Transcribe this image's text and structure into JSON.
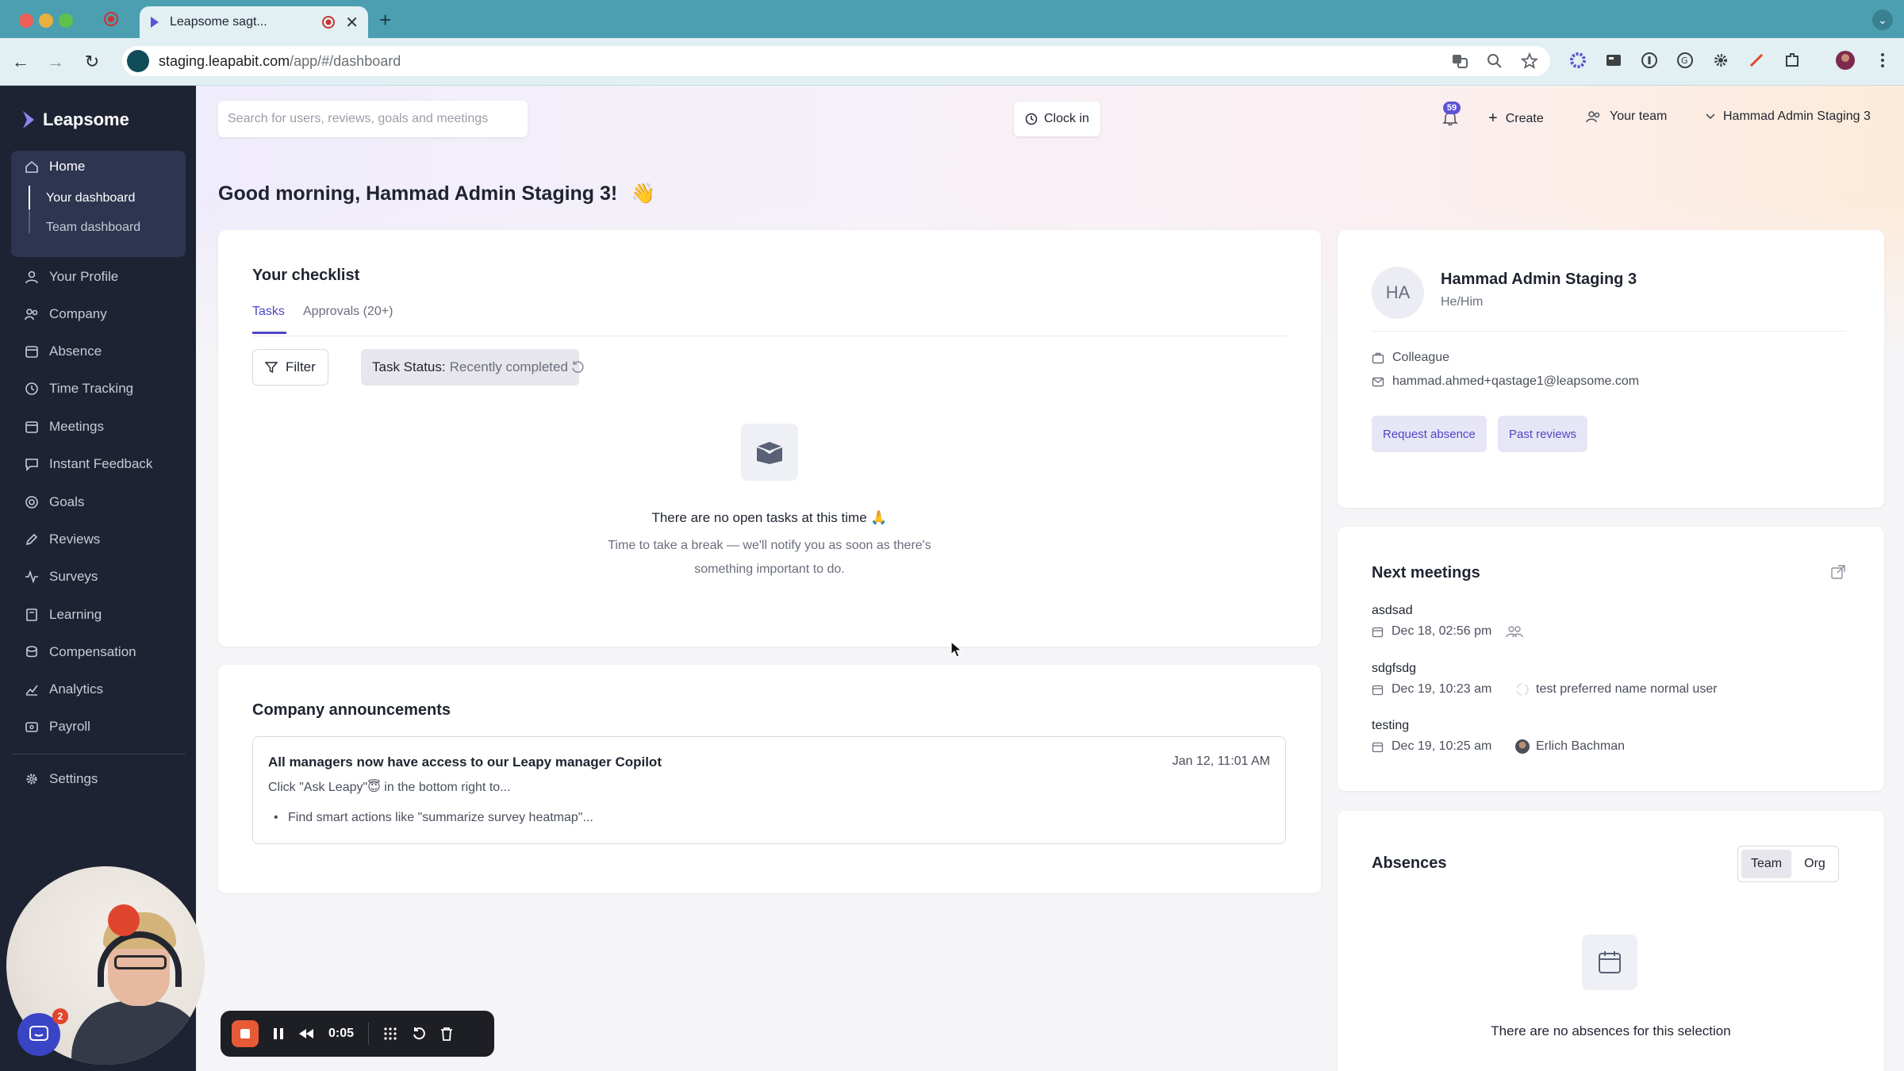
{
  "browser": {
    "tab_title": "Leapsome sagt...",
    "url_host": "staging.leapabit.com",
    "url_path": "/app/#/dashboard"
  },
  "app": {
    "logo_text": "Leapsome",
    "search_placeholder": "Search for users, reviews, goals and meetings",
    "clock_in": "Clock in",
    "notifications_count": "59",
    "create_label": "Create",
    "your_team_label": "Your team",
    "user_menu_label": "Hammad Admin Staging 3"
  },
  "sidebar": {
    "home": "Home",
    "home_sub": [
      "Your dashboard",
      "Team dashboard"
    ],
    "items": [
      "Your Profile",
      "Company",
      "Absence",
      "Time Tracking",
      "Meetings",
      "Instant Feedback",
      "Goals",
      "Reviews",
      "Surveys",
      "Learning",
      "Compensation",
      "Analytics",
      "Payroll"
    ],
    "settings": "Settings"
  },
  "greeting": {
    "text": "Good morning, Hammad Admin Staging 3!",
    "emoji": "👋"
  },
  "checklist": {
    "title": "Your checklist",
    "tabs": [
      "Tasks",
      "Approvals (20+)"
    ],
    "filter_label": "Filter",
    "status_label": "Task Status:",
    "status_value": "Recently completed",
    "empty_title": "There are no open tasks at this time 🙏",
    "empty_desc": "Time to take a break — we'll notify you as soon as there's something important to do."
  },
  "announcements": {
    "title": "Company announcements",
    "items": [
      {
        "title": "All managers now have access to our Leapy manager Copilot",
        "date": "Jan 12, 11:01 AM",
        "body": "Click \"Ask Leapy\"😇 in the bottom right to...",
        "bullet": "Find smart actions like \"summarize survey heatmap\"..."
      }
    ]
  },
  "profile": {
    "initials": "HA",
    "name": "Hammad Admin Staging 3",
    "pronouns": "He/Him",
    "role": "Colleague",
    "email": "hammad.ahmed+qastage1@leapsome.com",
    "actions": [
      "Request absence",
      "Past reviews"
    ]
  },
  "meetings": {
    "title": "Next meetings",
    "items": [
      {
        "name": "asdsad",
        "date": "Dec 18, 02:56 pm",
        "attendee": ""
      },
      {
        "name": "sdgfsdg",
        "date": "Dec 19, 10:23 am",
        "attendee": "test preferred name normal user"
      },
      {
        "name": "testing",
        "date": "Dec 19, 10:25 am",
        "attendee": "Erlich Bachman"
      }
    ]
  },
  "absences": {
    "title": "Absences",
    "toggle": [
      "Team",
      "Org"
    ],
    "toggle_selected": "Team",
    "empty": "There are no absences for this selection"
  },
  "overlay": {
    "chat_badge": "2",
    "recording_time": "0:05"
  },
  "colors": {
    "sidebar_bg": "#1e2333",
    "accent": "#4f46c8",
    "tabbar": "#4b9fb0"
  }
}
